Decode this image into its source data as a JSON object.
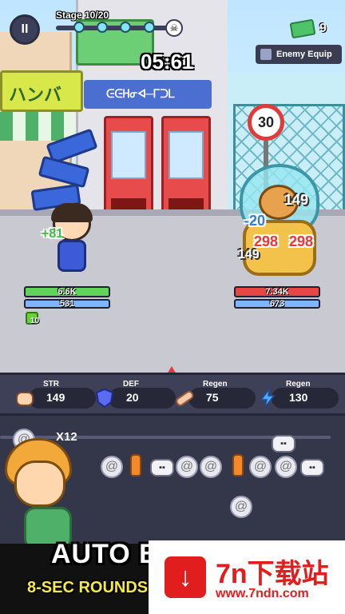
{
  "hud": {
    "stage_label": "Stage 10/20",
    "timer": "05:61",
    "cash": "9",
    "enemy_equip_label": "Enemy Equip",
    "pause_symbol": "II"
  },
  "scene": {
    "speed_limit": "30",
    "shop_sign": "ハンバ",
    "blue_sign": "ᕮᕮᕼᓂᐊ─ᒥᑐᒪ"
  },
  "player": {
    "hp": "6.6K",
    "defense": "531",
    "heal_popup": "+81",
    "weapon_level": "10"
  },
  "enemy": {
    "hp": "7.34K",
    "defense": "673",
    "damage_popups": [
      "149",
      "-20",
      "298",
      "298",
      "149"
    ]
  },
  "stats": [
    {
      "label": "STR",
      "value": "149",
      "icon": "fist-icon"
    },
    {
      "label": "DEF",
      "value": "20",
      "icon": "shield-icon"
    },
    {
      "label": "Regen",
      "value": "75",
      "icon": "bandage-icon"
    },
    {
      "label": "Regen",
      "value": "130",
      "icon": "lightning-icon"
    }
  ],
  "items": {
    "multiplier": "X12"
  },
  "promo": {
    "title": "AUTO BATTLE",
    "subtitle": "8-SEC ROUNDS"
  },
  "watermark": {
    "name": "7n下载站",
    "url": "www.7ndn.com"
  },
  "colors": {
    "player_hp": "#5fd35a",
    "enemy_hp": "#e84545",
    "defense": "#7fb5ff",
    "damage_text": "#e83838",
    "heal_text": "#3fbf3f"
  }
}
